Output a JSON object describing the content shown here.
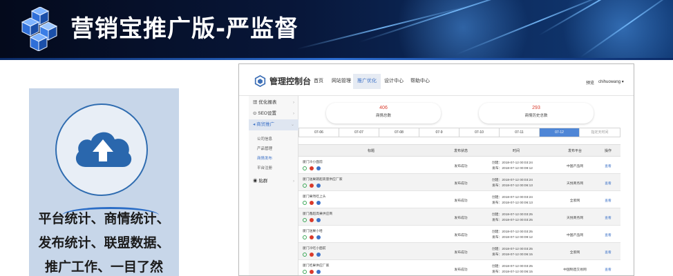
{
  "banner": {
    "title": "营销宝推广版-严监督"
  },
  "left_panel": {
    "lines": [
      "平台统计、商情统计、",
      "发布统计、联盟数据、",
      "推广工作、一目了然"
    ],
    "icon": "cloud-upload-icon"
  },
  "console": {
    "title": "管理控制台",
    "nav": [
      "首页",
      "网站管理",
      "推广优化",
      "设计中心",
      "帮助中心"
    ],
    "nav_active": "推广优化",
    "top_right": {
      "link": "预览",
      "user": "chihuowang ▾"
    },
    "sidebar": {
      "items": [
        {
          "label": "优化报表",
          "icon": "report-icon"
        },
        {
          "label": "SEO设置",
          "icon": "seo-icon"
        },
        {
          "label": "商贸推广",
          "icon": "promotion-icon",
          "active": true
        }
      ],
      "subitems": [
        "公司信息",
        "产品管理",
        "商情发布",
        "平台注册"
      ],
      "subitem_active": "商情发布",
      "last_item": {
        "label": "贴群",
        "icon": "group-icon"
      }
    },
    "stats": [
      {
        "value": "406",
        "label": "商情总数"
      },
      {
        "value": "293",
        "label": "商情历史总数"
      }
    ],
    "date_tabs": [
      "07-06",
      "07-07",
      "07-08",
      "07-9",
      "07-10",
      "07-11",
      "07-12"
    ],
    "date_tab_active": "07-12",
    "date_more": "指定天时间",
    "table": {
      "headers": [
        "标题",
        "发布状态",
        "时间",
        "发布平台",
        "操作"
      ],
      "rows": [
        {
          "title": "厦门冷小面前",
          "status": "发布成功",
          "created": "创建：2018-07-12 00:03:24",
          "published": "发布：2018-07-12 00:09:12",
          "platform": "中国产品网",
          "action": "查看"
        },
        {
          "title": "厦门送果蔬超高量供应厂家",
          "status": "发布成功",
          "created": "创建：2018-07-12 00:03:24",
          "published": "发布：2018-07-12 00:06:13",
          "platform": "天悦商务网",
          "action": "查看"
        },
        {
          "title": "厦门果然吃上头",
          "status": "发布成功",
          "created": "创建：2018-07-12 00:03:24",
          "published": "发布：2018-07-12 00:06:13",
          "platform": "全索网",
          "action": "查看"
        },
        {
          "title": "厦门鑫超高果供应商",
          "status": "发布成功",
          "created": "创建：2018-07-12 00:03:25",
          "published": "发布：2018-07-12 00:03:25",
          "platform": "天悦商务网",
          "action": "查看"
        },
        {
          "title": "厦门送果小哈",
          "status": "发布成功",
          "created": "创建：2018-07-12 00:03:25",
          "published": "发布：2018-07-12 00:09:12",
          "platform": "中国产品网",
          "action": "查看"
        },
        {
          "title": "厦门冷吃小面前",
          "status": "发布成功",
          "created": "创建：2018-07-12 00:03:25",
          "published": "发布：2018-07-12 00:06:15",
          "platform": "全索网",
          "action": "查看"
        },
        {
          "title": "厦门吃果供应厂家",
          "status": "发布成功",
          "created": "创建：2018-07-12 00:03:25",
          "published": "发布：2018-07-12 00:06:15",
          "platform": "中国制造交易网",
          "action": "查看"
        }
      ],
      "row_icons": [
        "refresh-icon",
        "weibo-icon",
        "baidu-icon"
      ]
    }
  },
  "colors": {
    "banner_dark": "#040a1c",
    "accent_blue": "#3d72c7",
    "stat_red": "#d93a2b",
    "panel_bg": "#c7d6e9"
  }
}
